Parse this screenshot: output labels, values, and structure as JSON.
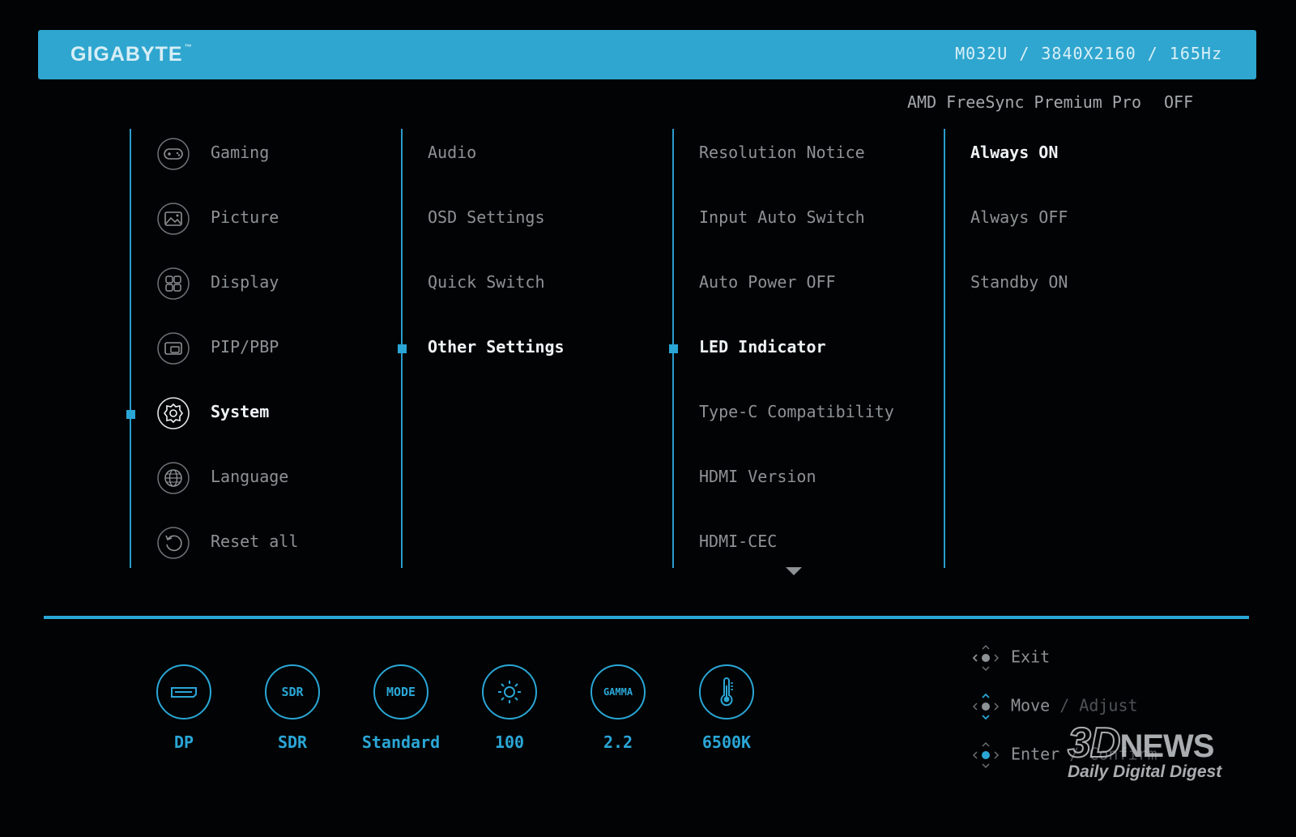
{
  "header": {
    "brand": "GIGABYTE",
    "brand_tm": "™",
    "model": "M032U",
    "resolution": "3840X2160",
    "refresh": "165Hz",
    "separator": "/"
  },
  "freesync": {
    "label": "AMD FreeSync Premium Pro",
    "value": "OFF"
  },
  "main_menu": [
    {
      "label": "Gaming",
      "icon": "gamepad-icon"
    },
    {
      "label": "Picture",
      "icon": "picture-icon"
    },
    {
      "label": "Display",
      "icon": "display-grid-icon"
    },
    {
      "label": "PIP/PBP",
      "icon": "pip-icon"
    },
    {
      "label": "System",
      "icon": "gear-icon",
      "active": true
    },
    {
      "label": "Language",
      "icon": "globe-icon"
    },
    {
      "label": "Reset all",
      "icon": "reset-icon"
    }
  ],
  "system_menu": [
    {
      "label": "Audio"
    },
    {
      "label": "OSD Settings"
    },
    {
      "label": "Quick Switch"
    },
    {
      "label": "Other Settings",
      "active": true
    }
  ],
  "other_settings_menu": [
    {
      "label": "Resolution Notice"
    },
    {
      "label": "Input Auto Switch"
    },
    {
      "label": "Auto Power OFF"
    },
    {
      "label": "LED Indicator",
      "active": true
    },
    {
      "label": "Type-C Compatibility"
    },
    {
      "label": "HDMI Version"
    },
    {
      "label": "HDMI-CEC"
    }
  ],
  "led_options": [
    {
      "label": "Always ON",
      "active": true
    },
    {
      "label": "Always OFF"
    },
    {
      "label": "Standby ON"
    }
  ],
  "status_bar": [
    {
      "value": "DP",
      "icon": "input-port-icon",
      "badge": ""
    },
    {
      "value": "SDR",
      "icon": "sdr-icon",
      "badge": "SDR"
    },
    {
      "value": "Standard",
      "icon": "mode-icon",
      "badge": "MODE"
    },
    {
      "value": "100",
      "icon": "brightness-icon",
      "badge": ""
    },
    {
      "value": "2.2",
      "icon": "gamma-icon",
      "badge": "GAMMA"
    },
    {
      "value": "6500K",
      "icon": "thermometer-icon",
      "badge": ""
    }
  ],
  "hints": {
    "exit": "Exit",
    "move": "Move",
    "adjust": "/ Adjust",
    "enter": "Enter",
    "confirm": "/ Confirm"
  },
  "watermark": {
    "logo_3d": "3D",
    "logo_news": "NEWS",
    "tagline": "Daily Digital Digest"
  },
  "colors": {
    "accent": "#2aa6d6",
    "header_bg": "#2fa6cf",
    "background": "#020304"
  }
}
